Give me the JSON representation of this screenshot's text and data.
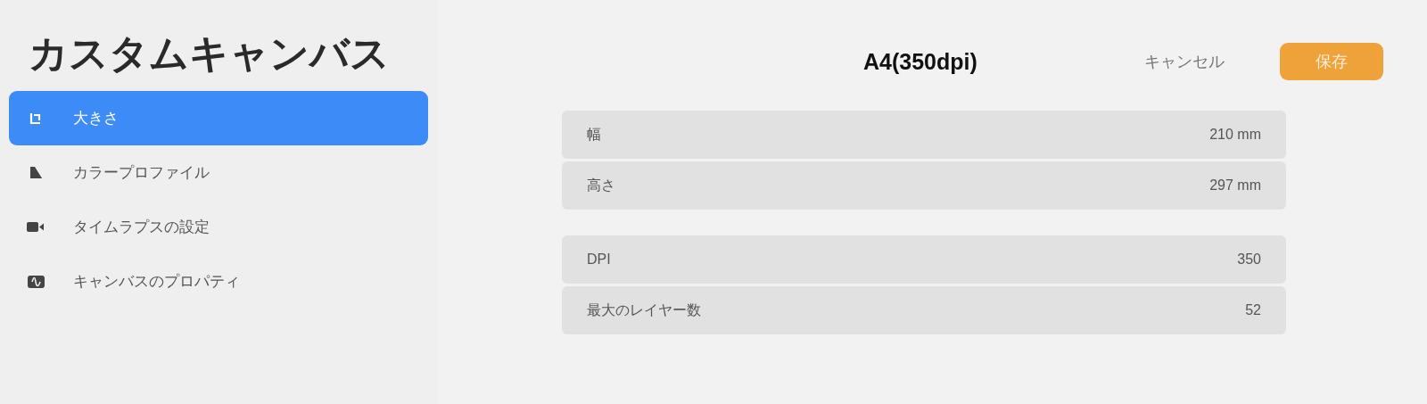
{
  "sidebar": {
    "title": "カスタムキャンバス",
    "items": [
      {
        "label": "大きさ",
        "selected": true
      },
      {
        "label": "カラープロファイル",
        "selected": false
      },
      {
        "label": "タイムラプスの設定",
        "selected": false
      },
      {
        "label": "キャンバスのプロパティ",
        "selected": false
      }
    ]
  },
  "header": {
    "title": "A4(350dpi)",
    "cancel": "キャンセル",
    "save": "保存"
  },
  "groups": [
    {
      "rows": [
        {
          "label": "幅",
          "value": "210 mm"
        },
        {
          "label": "高さ",
          "value": "297 mm"
        }
      ]
    },
    {
      "rows": [
        {
          "label": "DPI",
          "value": "350"
        },
        {
          "label": "最大のレイヤー数",
          "value": "52"
        }
      ]
    }
  ]
}
